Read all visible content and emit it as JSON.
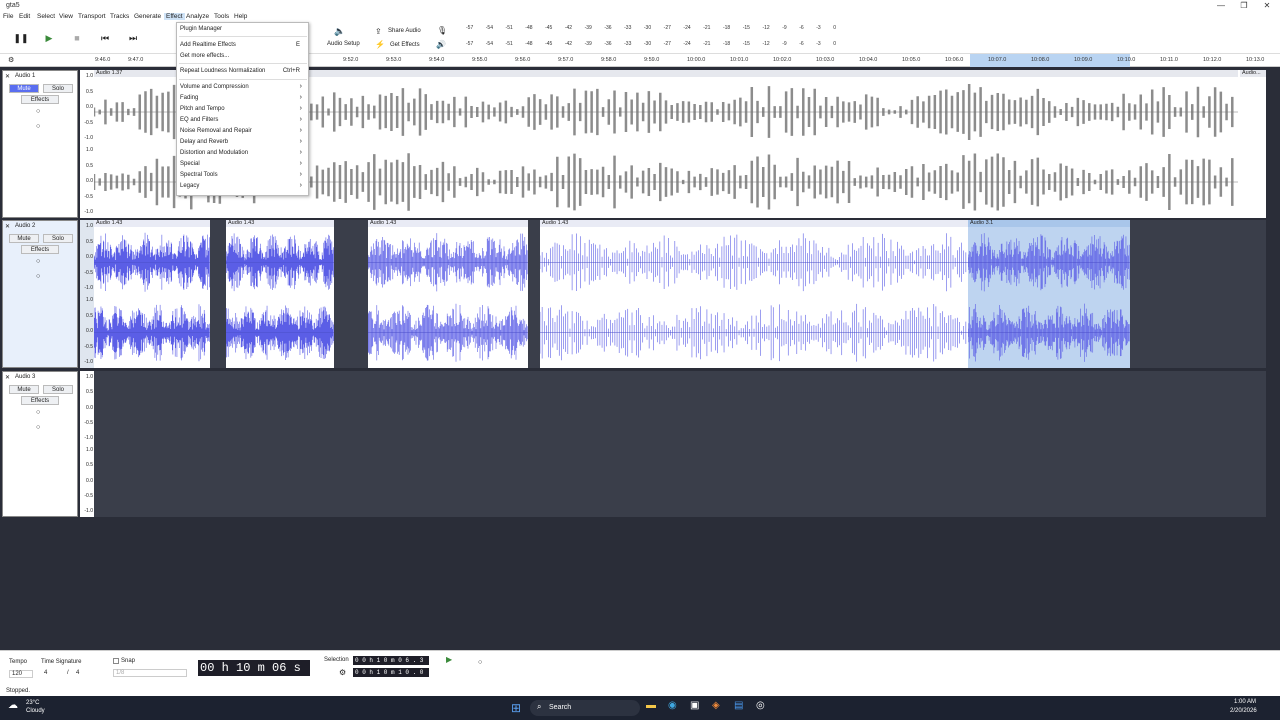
{
  "window": {
    "title": "gta5",
    "minimize": "—",
    "maximize": "❐",
    "close": "✕"
  },
  "menubar": [
    "File",
    "Edit",
    "Select",
    "View",
    "Transport",
    "Tracks",
    "Generate",
    "Effect",
    "Analyze",
    "Tools",
    "Help"
  ],
  "toolbar": {
    "share_audio": "Share Audio",
    "get_effects": "Get Effects",
    "audio_setup": "Audio Setup"
  },
  "meter_scale": [
    "-57",
    "-54",
    "-51",
    "-48",
    "-45",
    "-42",
    "-39",
    "-36",
    "-33",
    "-30",
    "-27",
    "-24",
    "-21",
    "-18",
    "-15",
    "-12",
    "-9",
    "-6",
    "-3",
    "0"
  ],
  "ruler": {
    "ticks": [
      "9:46.0",
      "9:47.0",
      "9:52.0",
      "9:53.0",
      "9:54.0",
      "9:55.0",
      "9:56.0",
      "9:57.0",
      "9:58.0",
      "9:59.0",
      "10:00.0",
      "10:01.0",
      "10:02.0",
      "10:03.0",
      "10:04.0",
      "10:05.0",
      "10:06.0",
      "10:07.0",
      "10:08.0",
      "10:09.0",
      "10:10.0",
      "10:11.0",
      "10:12.0",
      "10:13.0"
    ]
  },
  "effect_menu": {
    "items": [
      {
        "label": "Plugin Manager",
        "shortcut": "",
        "submenu": false
      },
      {
        "label": "Add Realtime Effects",
        "shortcut": "E",
        "submenu": false
      },
      {
        "label": "Get more effects...",
        "shortcut": "",
        "submenu": false
      },
      {
        "label": "Repeat Loudness Normalization",
        "shortcut": "Ctrl+R",
        "submenu": false
      },
      {
        "label": "Volume and Compression",
        "shortcut": "",
        "submenu": true
      },
      {
        "label": "Fading",
        "shortcut": "",
        "submenu": true
      },
      {
        "label": "Pitch and Tempo",
        "shortcut": "",
        "submenu": true
      },
      {
        "label": "EQ and Filters",
        "shortcut": "",
        "submenu": true
      },
      {
        "label": "Noise Removal and Repair",
        "shortcut": "",
        "submenu": true
      },
      {
        "label": "Delay and Reverb",
        "shortcut": "",
        "submenu": true
      },
      {
        "label": "Distortion and Modulation",
        "shortcut": "",
        "submenu": true
      },
      {
        "label": "Special",
        "shortcut": "",
        "submenu": true
      },
      {
        "label": "Spectral Tools",
        "shortcut": "",
        "submenu": true
      },
      {
        "label": "Legacy",
        "shortcut": "",
        "submenu": true
      }
    ]
  },
  "tracks": [
    {
      "name": "Audio 1",
      "mute": "Mute",
      "solo": "Solo",
      "effects": "Effects",
      "mute_on": true,
      "clips": [
        {
          "label": "Audio 1.37"
        },
        {
          "label": "Audio..."
        }
      ]
    },
    {
      "name": "Audio 2",
      "mute": "Mute",
      "solo": "Solo",
      "effects": "Effects",
      "mute_on": false,
      "clips": [
        {
          "label": "Audio 1.43"
        },
        {
          "label": "Audio 1.43"
        },
        {
          "label": "Audio 1.43"
        },
        {
          "label": "Audio 1.43"
        },
        {
          "label": "Audio 3.1"
        }
      ]
    },
    {
      "name": "Audio 3",
      "mute": "Mute",
      "solo": "Solo",
      "effects": "Effects",
      "mute_on": false,
      "clips": []
    }
  ],
  "scale_labels": [
    "1.0",
    "0.5",
    "0.0",
    "-0.5",
    "-1.0"
  ],
  "bottom": {
    "tempo_label": "Tempo",
    "tempo_value": "120",
    "timesig_label": "Time Signature",
    "ts_num": "4",
    "ts_den": "4",
    "snap_label": "Snap",
    "snap_value": "1/8",
    "time_display": "00 h 10 m 06 s",
    "selection_label": "Selection",
    "sel_start": "0 0 h 1 0 m 0 6 . 3 1 9 s",
    "sel_end": "0 0 h 1 0 m 1 0 . 0 5 8 s"
  },
  "status": "Stopped.",
  "taskbar": {
    "weather_temp": "23°C",
    "weather_desc": "Cloudy",
    "search": "Search",
    "time": "1:00 AM",
    "date": "2/20/2026"
  }
}
